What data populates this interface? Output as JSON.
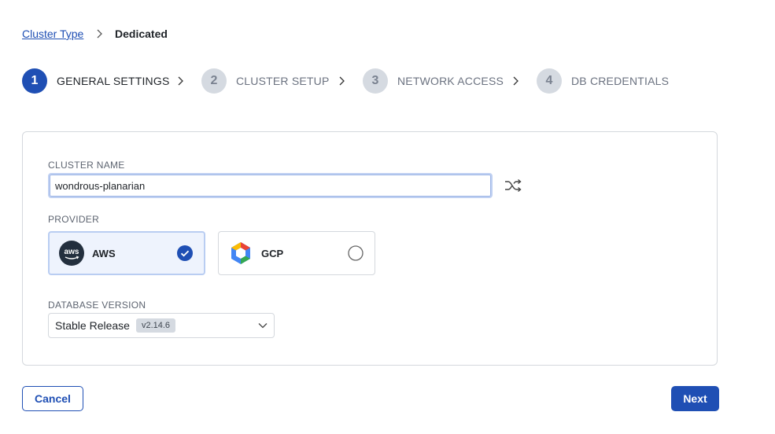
{
  "breadcrumb": {
    "parent": "Cluster Type",
    "current": "Dedicated"
  },
  "steps": [
    {
      "number": "1",
      "label": "GENERAL SETTINGS"
    },
    {
      "number": "2",
      "label": "CLUSTER SETUP"
    },
    {
      "number": "3",
      "label": "NETWORK ACCESS"
    },
    {
      "number": "4",
      "label": "DB CREDENTIALS"
    }
  ],
  "active_step": 1,
  "cluster_name": {
    "label": "CLUSTER NAME",
    "value": "wondrous-planarian",
    "shuffle_icon": "shuffle-icon"
  },
  "provider": {
    "label": "PROVIDER",
    "options": [
      {
        "label": "AWS",
        "logo_text": "aws",
        "icon": "aws-logo-icon",
        "selected": true
      },
      {
        "label": "GCP",
        "icon": "gcp-logo-icon",
        "selected": false
      }
    ]
  },
  "database_version": {
    "label": "DATABASE VERSION",
    "selected": "Stable Release",
    "badge": "v2.14.6"
  },
  "actions": {
    "cancel": "Cancel",
    "next": "Next"
  },
  "colors": {
    "primary": "#1f4fb4",
    "selected_tile_bg": "#eef3fd",
    "border": "#d4d8dd"
  }
}
